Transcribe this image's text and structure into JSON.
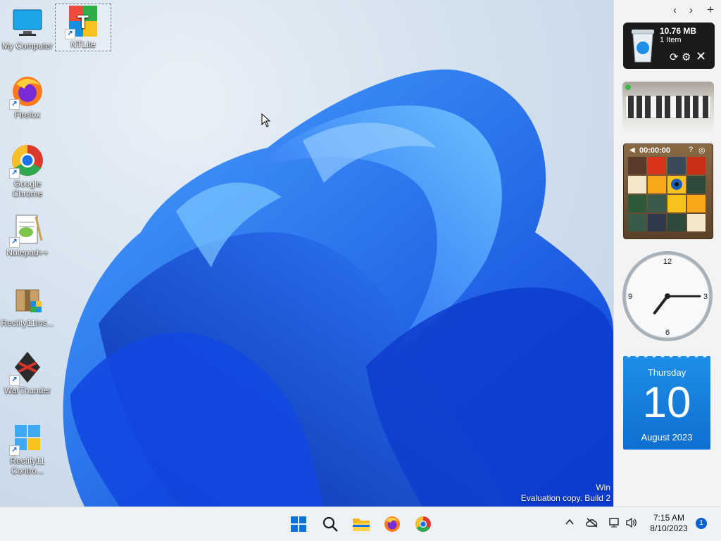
{
  "desktop": {
    "icons": [
      {
        "label": "My Computer"
      },
      {
        "label": "NTLite"
      },
      {
        "label": "Firefox"
      },
      {
        "label": "Google Chrome"
      },
      {
        "label": "Notepad++"
      },
      {
        "label": "Rectify11Ins..."
      },
      {
        "label": "WarThunder"
      },
      {
        "label": "Rectify11 Contro..."
      }
    ],
    "watermark": {
      "line1": "Win",
      "line2": "Evaluation copy. Build 2"
    }
  },
  "sidebar": {
    "controls": {
      "prev": "‹",
      "next": "›",
      "add": "+"
    },
    "recycle_bin": {
      "size": "10.76 MB",
      "items": "1 Item"
    },
    "puzzle": {
      "timer": "00:00:00"
    },
    "clock": {
      "numbers": [
        "12",
        "3",
        "6",
        "9"
      ],
      "time": "7:15"
    },
    "calendar": {
      "weekday": "Thursday",
      "day": "10",
      "month_year": "August 2023"
    }
  },
  "taskbar": {
    "apps": [
      "Start",
      "Search",
      "File Explorer",
      "Firefox",
      "Google Chrome"
    ],
    "time": "7:15 AM",
    "date": "8/10/2023",
    "notification_count": "1",
    "tray_chevron": "^"
  },
  "colors": {
    "accent": "#1a73e8",
    "taskbar": "#eef1f5",
    "sidebar": "#f3f3f3"
  }
}
